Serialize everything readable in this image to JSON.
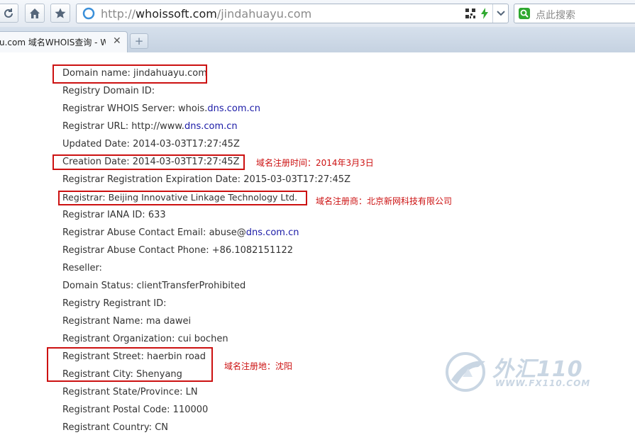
{
  "browser": {
    "url_scheme": "http://",
    "url_host": "whoissoft.com",
    "url_path": "/jindahuayu.com",
    "search_placeholder": "点此搜索",
    "tab_title": "u.com 域名WHOIS查询 - WI",
    "tab_close": "✕",
    "new_tab": "+"
  },
  "whois": {
    "lines": [
      {
        "label": "Domain name:",
        "value": "jindahuayu.com"
      },
      {
        "label": "Registry Domain ID:",
        "value": ""
      },
      {
        "label": "Registrar WHOIS Server:",
        "value_prefix": "whois.",
        "value_link": "dns.com.cn"
      },
      {
        "label": "Registrar URL:",
        "value_prefix": "http://www.",
        "value_link": "dns.com.cn"
      },
      {
        "label": "Updated Date:",
        "value": "2014-03-03T17:27:45Z"
      },
      {
        "label": "Creation Date:",
        "value": "2014-03-03T17:27:45Z"
      },
      {
        "label": "Registrar Registration Expiration Date:",
        "value": "2015-03-03T17:27:45Z"
      },
      {
        "label": "Registrar:",
        "value": "Beijing Innovative Linkage Technology Ltd."
      },
      {
        "label": "Registrar IANA ID:",
        "value": "633"
      },
      {
        "label": "Registrar Abuse Contact Email:",
        "value_prefix": "abuse@",
        "value_link": "dns.com.cn"
      },
      {
        "label": "Registrar Abuse Contact Phone:",
        "value": "+86.1082151122"
      },
      {
        "label": "Reseller:",
        "value": ""
      },
      {
        "label": "Domain Status:",
        "value": "clientTransferProhibited"
      },
      {
        "label": "Registry Registrant ID:",
        "value": ""
      },
      {
        "label": "Registrant Name:",
        "value": "ma dawei"
      },
      {
        "label": "Registrant Organization:",
        "value": "cui bochen"
      },
      {
        "label": "Registrant Street:",
        "value": "haerbin road"
      },
      {
        "label": "Registrant City:",
        "value": "Shenyang"
      },
      {
        "label": "Registrant State/Province:",
        "value": "LN"
      },
      {
        "label": "Registrant Postal Code:",
        "value": "110000"
      },
      {
        "label": "Registrant Country:",
        "value": "CN"
      }
    ]
  },
  "annotations": {
    "creation": "域名注册时间：2014年3月3日",
    "registrar": "域名注册商：北京新网科技有限公司",
    "location": "域名注册地：沈阳"
  },
  "watermark": {
    "title": "外汇110",
    "url": "WWW.FX110.COM"
  },
  "colors": {
    "highlight_border": "#cc1111",
    "link": "#1a1aa6"
  }
}
